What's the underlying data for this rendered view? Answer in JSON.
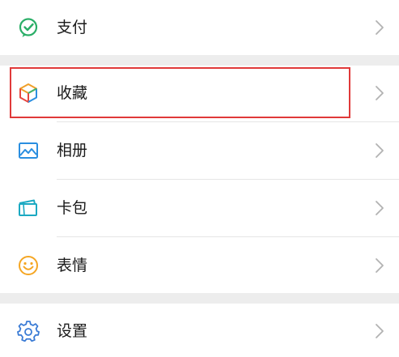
{
  "menu": {
    "items": [
      {
        "key": "pay",
        "label": "支付",
        "icon": "wechat-pay-icon"
      },
      {
        "key": "favorites",
        "label": "收藏",
        "icon": "cube-favorites-icon"
      },
      {
        "key": "album",
        "label": "相册",
        "icon": "image-album-icon"
      },
      {
        "key": "cards",
        "label": "卡包",
        "icon": "card-wallet-icon"
      },
      {
        "key": "stickers",
        "label": "表情",
        "icon": "smiley-icon"
      },
      {
        "key": "settings",
        "label": "设置",
        "icon": "gear-icon"
      }
    ]
  },
  "colors": {
    "pay_green": "#2aae67",
    "album_blue": "#2a8ee0",
    "card_teal": "#1ba9c2",
    "smiley_orange": "#f5a623",
    "settings_blue": "#3a7bd5",
    "highlight_red": "#e03a3a",
    "section_gap": "#ededed",
    "chevron_gray": "#b2b2b2"
  },
  "annotation": {
    "highlighted_item": "favorites"
  }
}
